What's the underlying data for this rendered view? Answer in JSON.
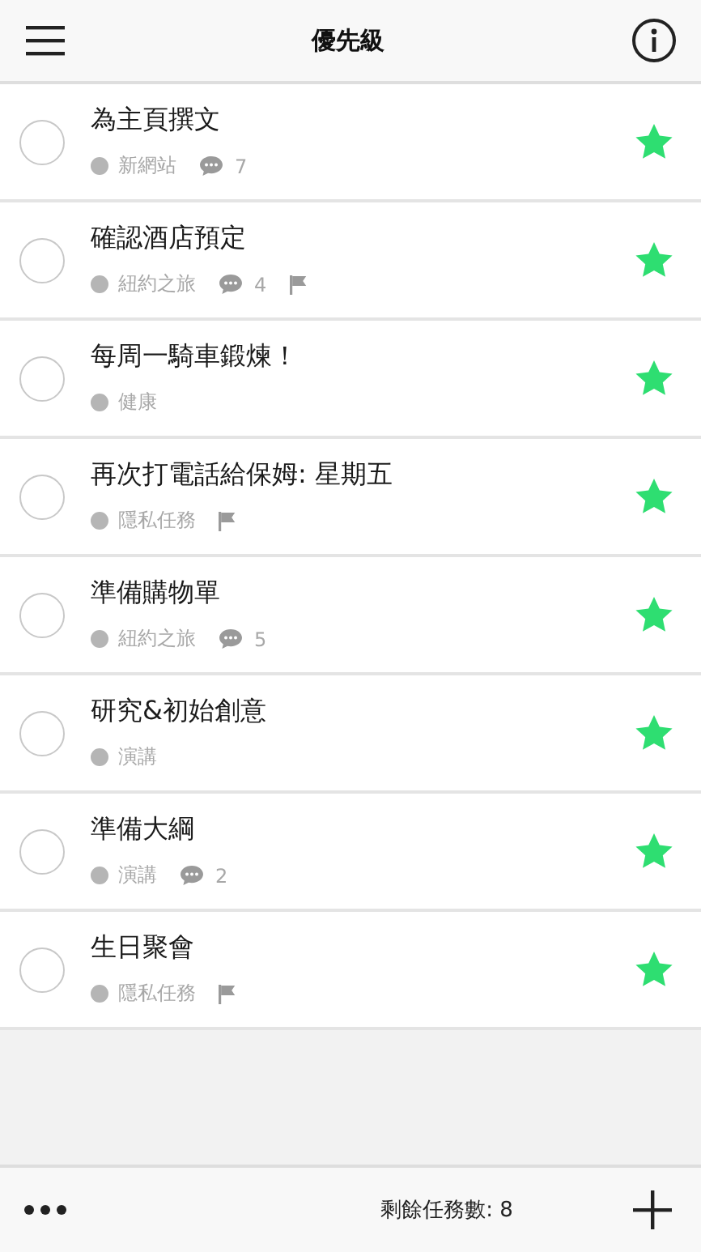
{
  "header": {
    "title": "優先級"
  },
  "tasks": [
    {
      "title": "為主頁撰文",
      "project": "新網站",
      "comments": "7",
      "flagged": false,
      "starred": true,
      "done": false
    },
    {
      "title": "確認酒店預定",
      "project": "紐約之旅",
      "comments": "4",
      "flagged": true,
      "starred": true,
      "done": false
    },
    {
      "title": "每周一騎車鍛煉！",
      "project": "健康",
      "flagged": false,
      "starred": true,
      "done": false
    },
    {
      "title": "再次打電話給保姆: 星期五",
      "project": "隱私任務",
      "flagged": true,
      "starred": true,
      "done": false
    },
    {
      "title": "準備購物單",
      "project": "紐約之旅",
      "comments": "5",
      "flagged": false,
      "starred": true,
      "done": false
    },
    {
      "title": "研究&初始創意",
      "project": "演講",
      "flagged": false,
      "starred": true,
      "done": false
    },
    {
      "title": "準備大綱",
      "project": "演講",
      "comments": "2",
      "flagged": false,
      "starred": true,
      "done": false
    },
    {
      "title": "生日聚會",
      "project": "隱私任務",
      "flagged": true,
      "starred": true,
      "done": false
    }
  ],
  "footer": {
    "remaining": "剩餘任務數: 8"
  }
}
